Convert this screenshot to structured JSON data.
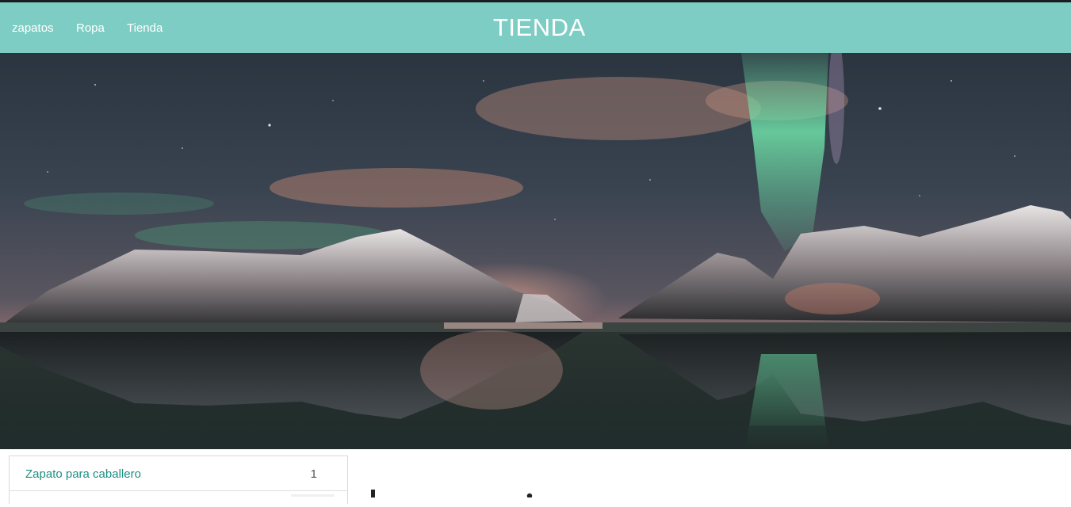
{
  "nav": {
    "links": [
      {
        "label": "zapatos"
      },
      {
        "label": "Ropa"
      },
      {
        "label": "Tienda"
      }
    ],
    "brand": "TIENDA"
  },
  "colors": {
    "navbar": "#7ecdc4",
    "link_accent": "#1d8f83"
  },
  "hero": {
    "image": "northern lights over snowy mountains reflected in a lake"
  },
  "sidebar": {
    "items": [
      {
        "label": "Zapato para caballero",
        "count": "1"
      }
    ]
  }
}
